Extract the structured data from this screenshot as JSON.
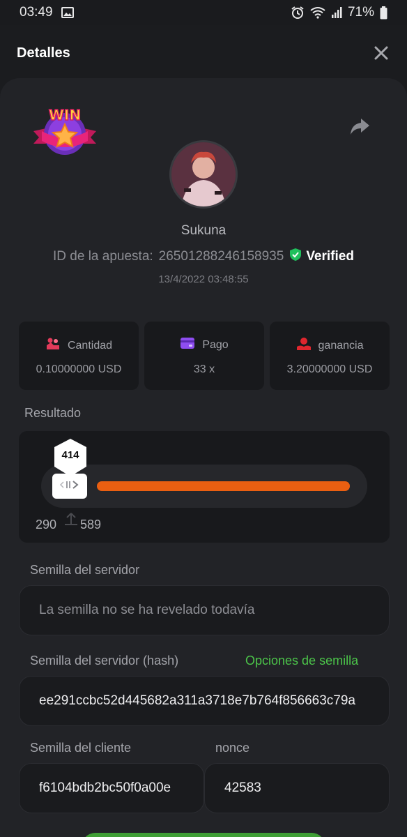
{
  "status_bar": {
    "time": "03:49",
    "battery": "71%"
  },
  "header": {
    "title": "Detalles"
  },
  "bet": {
    "username": "Sukuna",
    "bet_id_label": "ID de la apuesta:",
    "bet_id": "26501288246158935",
    "verified_label": "Verified",
    "datetime": "13/4/2022 03:48:55",
    "badge_text": "WIN"
  },
  "stats": [
    {
      "label": "Cantidad",
      "value": "0.10000000 USD",
      "icon": "coins-icon"
    },
    {
      "label": "Pago",
      "value": "33 x",
      "icon": "card-icon"
    },
    {
      "label": "ganancia",
      "value": "3.20000000 USD",
      "icon": "profit-icon"
    }
  ],
  "result": {
    "label": "Resultado",
    "value": "414",
    "range_min": "290",
    "range_max": "589"
  },
  "server_seed": {
    "label": "Semilla del servidor",
    "placeholder": "La semilla no se ha revelado todavía"
  },
  "server_seed_hash": {
    "label": "Semilla del servidor (hash)",
    "link": "Opciones de semilla",
    "value": "ee291ccbc52d445682a311a3718e7b764f856663c79a"
  },
  "client_seed": {
    "label": "Semilla del cliente",
    "value": "f6104bdb2bc50f0a00e"
  },
  "nonce": {
    "label": "nonce",
    "value": "42583"
  },
  "colors": {
    "accent_orange": "#ea5f11",
    "accent_green": "#4cc54a",
    "verified_green": "#20c05c"
  }
}
